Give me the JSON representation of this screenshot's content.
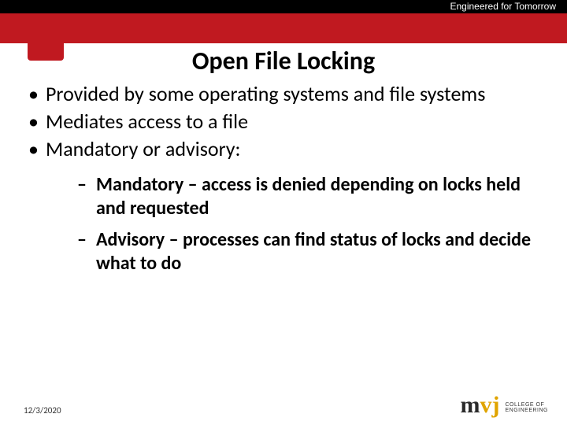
{
  "header": {
    "tagline": "Engineered for Tomorrow"
  },
  "title": "Open File Locking",
  "bullets": {
    "b1": "Provided by some operating systems and file systems",
    "b2": "Mediates access to a file",
    "b3": "Mandatory or advisory:",
    "s1": " Mandatory – access is denied depending on locks held and requested",
    "s2": "Advisory – processes can find status of locks and decide what to do"
  },
  "footer": {
    "date": "12/3/2020"
  },
  "logo": {
    "part1": "m",
    "part2": "vj",
    "line1": "COLLEGE OF",
    "line2": "ENGINEERING"
  }
}
